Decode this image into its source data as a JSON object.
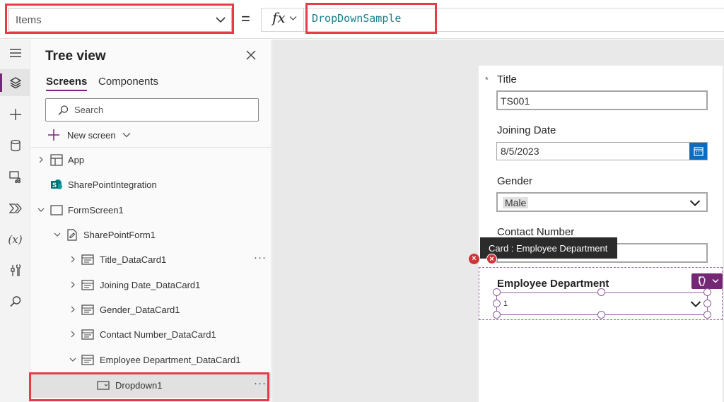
{
  "formula_bar": {
    "property": "Items",
    "equals": "=",
    "fx": "fx",
    "formula": "DropDownSample"
  },
  "rail": {
    "icons": [
      "hamburger-icon",
      "tree-layers-icon",
      "plus-icon",
      "database-icon",
      "media-icon",
      "power-automate-icon",
      "variables-icon",
      "tools-icon",
      "search-icon"
    ],
    "variables_glyph": "(x)"
  },
  "tree_view": {
    "title": "Tree view",
    "tabs": [
      "Screens",
      "Components"
    ],
    "search_placeholder": "Search",
    "new_screen": "New screen",
    "nodes": [
      {
        "label": "App"
      },
      {
        "label": "SharePointIntegration"
      },
      {
        "label": "FormScreen1"
      },
      {
        "label": "SharePointForm1"
      },
      {
        "label": "Title_DataCard1"
      },
      {
        "label": "Joining Date_DataCard1"
      },
      {
        "label": "Gender_DataCard1"
      },
      {
        "label": "Contact Number_DataCard1"
      },
      {
        "label": "Employee Department_DataCard1"
      },
      {
        "label": "Dropdown1"
      }
    ],
    "more": "···"
  },
  "form": {
    "required_mark": "*",
    "title_label": "Title",
    "title_value": "TS001",
    "joining_label": "Joining Date",
    "joining_value": "8/5/2023",
    "gender_label": "Gender",
    "gender_value": "Male",
    "contact_label": "Contact Number",
    "tooltip": "Card : Employee Department",
    "emp_label": "Employee Department",
    "emp_value": "1"
  },
  "colors": {
    "accent": "#742774",
    "highlight": "#e63b48",
    "formula_text": "#1a7f8a",
    "calendar": "#0f6cbd",
    "error": "#d13438"
  }
}
